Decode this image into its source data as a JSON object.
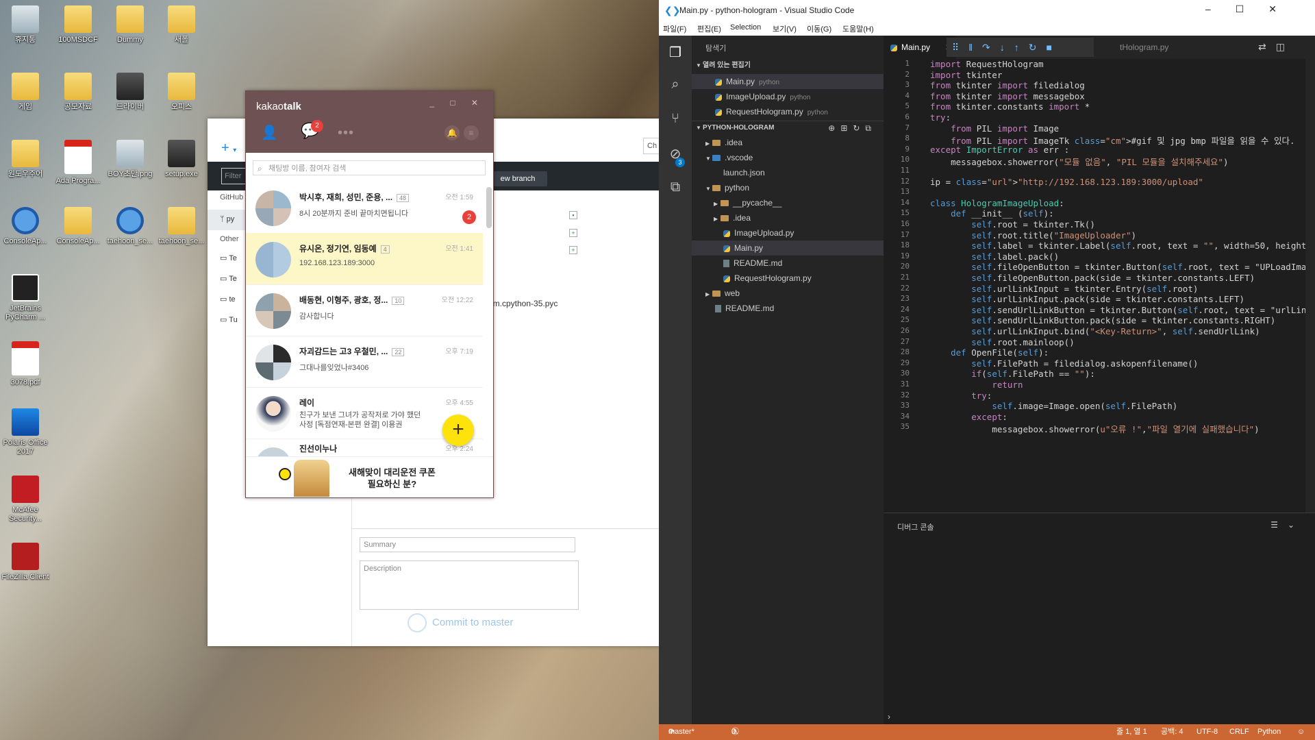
{
  "desktop": {
    "icons": [
      {
        "label": "휴지통",
        "icon": "recycle-bin-icon"
      },
      {
        "label": "100MSDCF",
        "icon": "folder-icon"
      },
      {
        "label": "Dummy",
        "icon": "folder-icon"
      },
      {
        "label": "새폴",
        "icon": "folder-icon"
      },
      {
        "label": "게임",
        "icon": "shortcut-icon"
      },
      {
        "label": "공모자료",
        "icon": "shortcut-icon"
      },
      {
        "label": "드라이버",
        "icon": "shortcut-icon"
      },
      {
        "label": "오피스",
        "icon": "shortcut-icon"
      },
      {
        "label": "원도우주어",
        "icon": "folder-icon"
      },
      {
        "label": "Ada Progra...",
        "icon": "pdf-icon"
      },
      {
        "label": "BOY초만.png",
        "icon": "image-file-icon"
      },
      {
        "label": "setup.exe",
        "icon": "installer-icon"
      },
      {
        "label": "ConsoleAp...",
        "icon": "zip-icon"
      },
      {
        "label": "ConsoleAp...",
        "icon": "shortcut-icon"
      },
      {
        "label": "taehoon_se...",
        "icon": "zip-icon"
      },
      {
        "label": "taehoon_se...",
        "icon": "shortcut-icon"
      },
      {
        "label": "JetBrains PyCharm ...",
        "icon": "pycharm-icon"
      },
      {
        "label": "3078.pdf",
        "icon": "pdf-icon"
      },
      {
        "label": "Polaris Office 2017",
        "icon": "polaris-icon"
      },
      {
        "label": "McAfee Security...",
        "icon": "mcafee-icon"
      },
      {
        "label": "FileZilla Client",
        "icon": "filezilla-icon"
      }
    ]
  },
  "github": {
    "filter_placeholder": "Filter",
    "section_github": "GitHub",
    "repo_selected": "py",
    "section_other": "Other",
    "other_items": [
      "Te",
      "Te",
      "te",
      "Tu"
    ],
    "new_branch": "ew branch",
    "tab_partial": "Ch",
    "changed_file": "am.cpython-35.pyc",
    "summary_placeholder": "Summary",
    "description_placeholder": "Description",
    "commit_label": "Commit to master"
  },
  "kakao": {
    "title_light": "kakao",
    "title_bold": "talk",
    "chat_badge": "2",
    "search_placeholder": "채팅방 이름, 참여자 검색",
    "chats": [
      {
        "name": "박시후, 재희, 성민, 준용, ...",
        "count": "48",
        "time": "오전 1:59",
        "msg": "8시 20분까지 준비 끝마치면됩니다",
        "unread": "2",
        "selected": false
      },
      {
        "name": "유시온, 정기연, 임동예",
        "count": "4",
        "time": "오전 1:41",
        "msg": "192.168.123.189:3000",
        "unread": "",
        "selected": true
      },
      {
        "name": "배동현, 이형주, 광호, 정...",
        "count": "10",
        "time": "오전 12:22",
        "msg": "감사합니다",
        "unread": "",
        "selected": false
      },
      {
        "name": "자괴감드는 고3 우철민, ...",
        "count": "22",
        "time": "오후 7:19",
        "msg": "그대나를잊었나#3406",
        "unread": "",
        "selected": false
      },
      {
        "name": "레이",
        "count": "",
        "time": "오후 4:55",
        "msg": "친구가 보낸 그녀가 공작저로 가야 했던",
        "msg2": "사정 [독점연재-본편 완결] 이용권",
        "unread": "",
        "selected": false
      },
      {
        "name": "진선이누나",
        "count": "",
        "time": "오후 2:24",
        "msg": "",
        "unread": "",
        "selected": false
      }
    ],
    "ad_line1": "새해맞이 대리운전 쿠폰",
    "ad_line2": "필요하신 분?"
  },
  "vscode": {
    "window_title": "Main.py - python-hologram - Visual Studio Code",
    "menu": [
      "파일(F)",
      "편집(E)",
      "Selection",
      "보기(V)",
      "이동(G)",
      "도움말(H)"
    ],
    "explorer_title": "탐색기",
    "open_editors_title": "열려 있는 편집기",
    "open_editors": [
      {
        "name": "Main.py",
        "dir": "python"
      },
      {
        "name": "ImageUpload.py",
        "dir": "python"
      },
      {
        "name": "RequestHologram.py",
        "dir": "python"
      }
    ],
    "project_title": "PYTHON-HOLOGRAM",
    "tree": [
      ".idea",
      ".vscode",
      "launch.json",
      "python",
      "__pycache__",
      ".idea",
      "ImageUpload.py",
      "Main.py",
      "README.md",
      "RequestHologram.py",
      "web",
      "README.md"
    ],
    "scm_badge": "3",
    "tab_active": "Main.py",
    "tab_other": "tHologram.py",
    "code_lines": [
      "import RequestHologram",
      "import tkinter",
      "from tkinter import filedialog",
      "from tkinter import messagebox",
      "from tkinter.constants import *",
      "try:",
      "    from PIL import Image",
      "    from PIL import ImageTk #gif 및 jpg bmp 파일을 읽을 수 있다.",
      "except ImportError as err :",
      "    messagebox.showerror(\"모듈 없음\", \"PIL 모듈을 설치해주세요\")",
      "",
      "ip = \"http://192.168.123.189:3000/upload\"",
      "",
      "class HologramImageUpload:",
      "    def __init__ (self):",
      "        self.root = tkinter.Tk()",
      "        self.root.title(\"ImageUploader\")",
      "        self.label = tkinter.Label(self.root, text = \"\", width=50, height",
      "        self.label.pack()",
      "        self.fileOpenButton = tkinter.Button(self.root, text = \"UPLoadIma",
      "        self.fileOpenButton.pack(side = tkinter.constants.LEFT)",
      "        self.urlLinkInput = tkinter.Entry(self.root)",
      "        self.urlLinkInput.pack(side = tkinter.constants.LEFT)",
      "        self.sendUrlLinkButton = tkinter.Button(self.root, text = \"urlLin",
      "        self.sendUrlLinkButton.pack(side = tkinter.constants.RIGHT)",
      "        self.urlLinkInput.bind(\"<Key-Return>\", self.sendUrlLink)",
      "        self.root.mainloop()",
      "    def OpenFile(self):",
      "        self.FilePath = filedialog.askopenfilename()",
      "        if(self.FilePath == \"\"):",
      "            return",
      "        try:",
      "            self.image=Image.open(self.FilePath)",
      "        except:",
      "            messagebox.showerror(u\"오류 !\",\"파일 열기에 실패했습니다\")"
    ],
    "panel_title": "디버그 콘솔",
    "status": {
      "branch": "master*",
      "errors": "0",
      "warnings": "0",
      "position": "줄 1, 열 1",
      "spaces": "공백: 4",
      "encoding": "UTF-8",
      "eol": "CRLF",
      "language": "Python"
    },
    "accent_status": "#cc6633"
  }
}
